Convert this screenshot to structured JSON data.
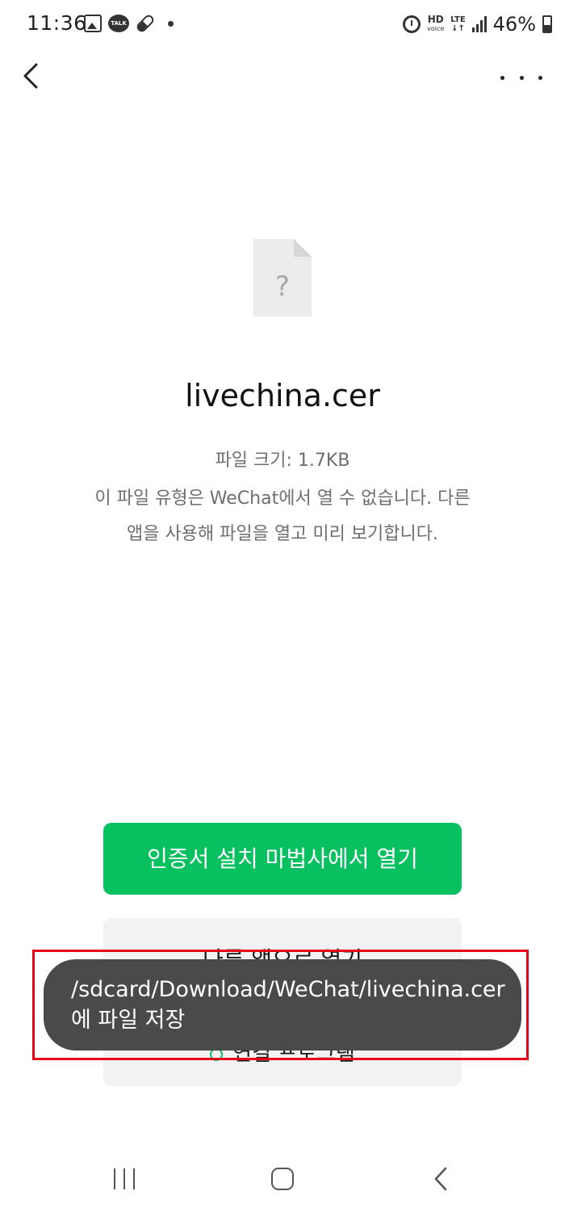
{
  "status_bar": {
    "time": "11:36",
    "talk_label": "TALK",
    "hd_label": "HD",
    "voice_label": "voice",
    "lte_label": "LTE",
    "battery_percent": "46%"
  },
  "file": {
    "name": "livechina.cer",
    "size_text": "파일 크기: 1.7KB",
    "description": "이 파일 유형은 WeChat에서 열 수 없습니다. 다른 앱을 사용해 파일을 열고 미리 보기합니다.",
    "icon_symbol": "?"
  },
  "actions": {
    "primary_label": "인증서 설치 마법사에서 열기",
    "other_app_label": "다른 앱으로 열기",
    "open_with_label": "연결 프로그램"
  },
  "toast": {
    "message": "/sdcard/Download/WeChat/livechina.cer에 파일 저장"
  },
  "colors": {
    "accent": "#07c160",
    "toast_bg": "#4a4a4a",
    "highlight": "#e6001a"
  }
}
